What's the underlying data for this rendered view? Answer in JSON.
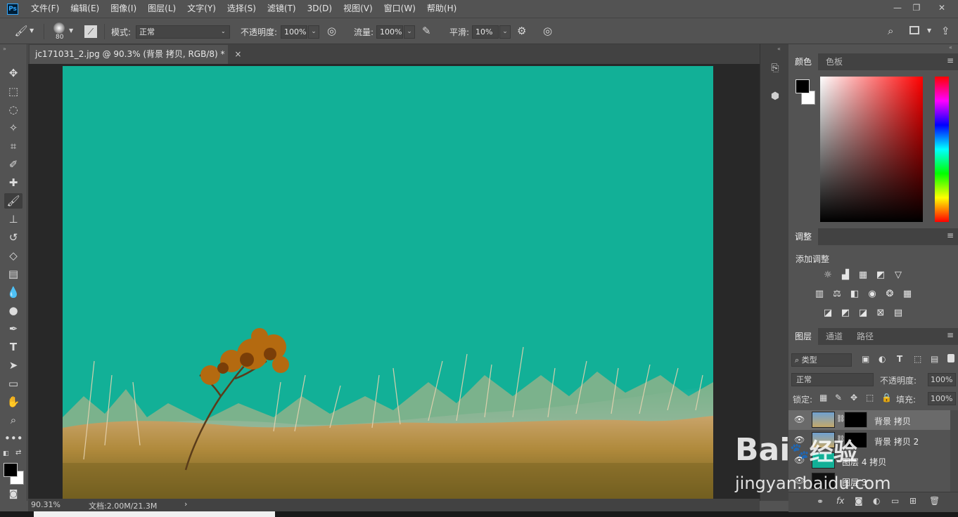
{
  "app": {
    "logo_text": "Ps"
  },
  "menu": [
    "文件(F)",
    "编辑(E)",
    "图像(I)",
    "图层(L)",
    "文字(Y)",
    "选择(S)",
    "滤镜(T)",
    "3D(D)",
    "视图(V)",
    "窗口(W)",
    "帮助(H)"
  ],
  "window_controls": {
    "minimize": "—",
    "restore": "❐",
    "close": "✕"
  },
  "options": {
    "brush_size": "80",
    "mode_label": "模式:",
    "mode_value": "正常",
    "opacity_label": "不透明度:",
    "opacity_value": "100%",
    "flow_label": "流量:",
    "flow_value": "100%",
    "smooth_label": "平滑:",
    "smooth_value": "10%"
  },
  "document": {
    "tab_title": "jc171031_2.jpg @ 90.3% (背景 拷贝, RGB/8) *",
    "close": "×",
    "bg_color": "#12b097"
  },
  "status": {
    "zoom": "90.31%",
    "doc_info": "文档:2.00M/21.3M",
    "arrow": "›"
  },
  "color_panel": {
    "tabs": [
      "颜色",
      "色板"
    ],
    "foreground": "#000000",
    "background": "#ffffff",
    "hue": "#ff0000"
  },
  "adjust_panel": {
    "tab": "调整",
    "add_label": "添加调整"
  },
  "layers_panel": {
    "tabs": [
      "图层",
      "通道",
      "路径"
    ],
    "filter_label": "类型",
    "blend_mode": "正常",
    "opacity_label": "不透明度:",
    "opacity_value": "100%",
    "lock_label": "锁定:",
    "fill_label": "填充:",
    "fill_value": "100%",
    "layers": [
      {
        "name": "背景 拷贝",
        "selected": true
      },
      {
        "name": "背景 拷贝 2",
        "selected": false
      },
      {
        "name": "图层 4 拷贝",
        "selected": false
      },
      {
        "name": "图层 3",
        "selected": false
      }
    ]
  },
  "watermark": {
    "brand": "Bai",
    "brand_suffix": "经验",
    "url": "jingyan.baidu.com"
  }
}
